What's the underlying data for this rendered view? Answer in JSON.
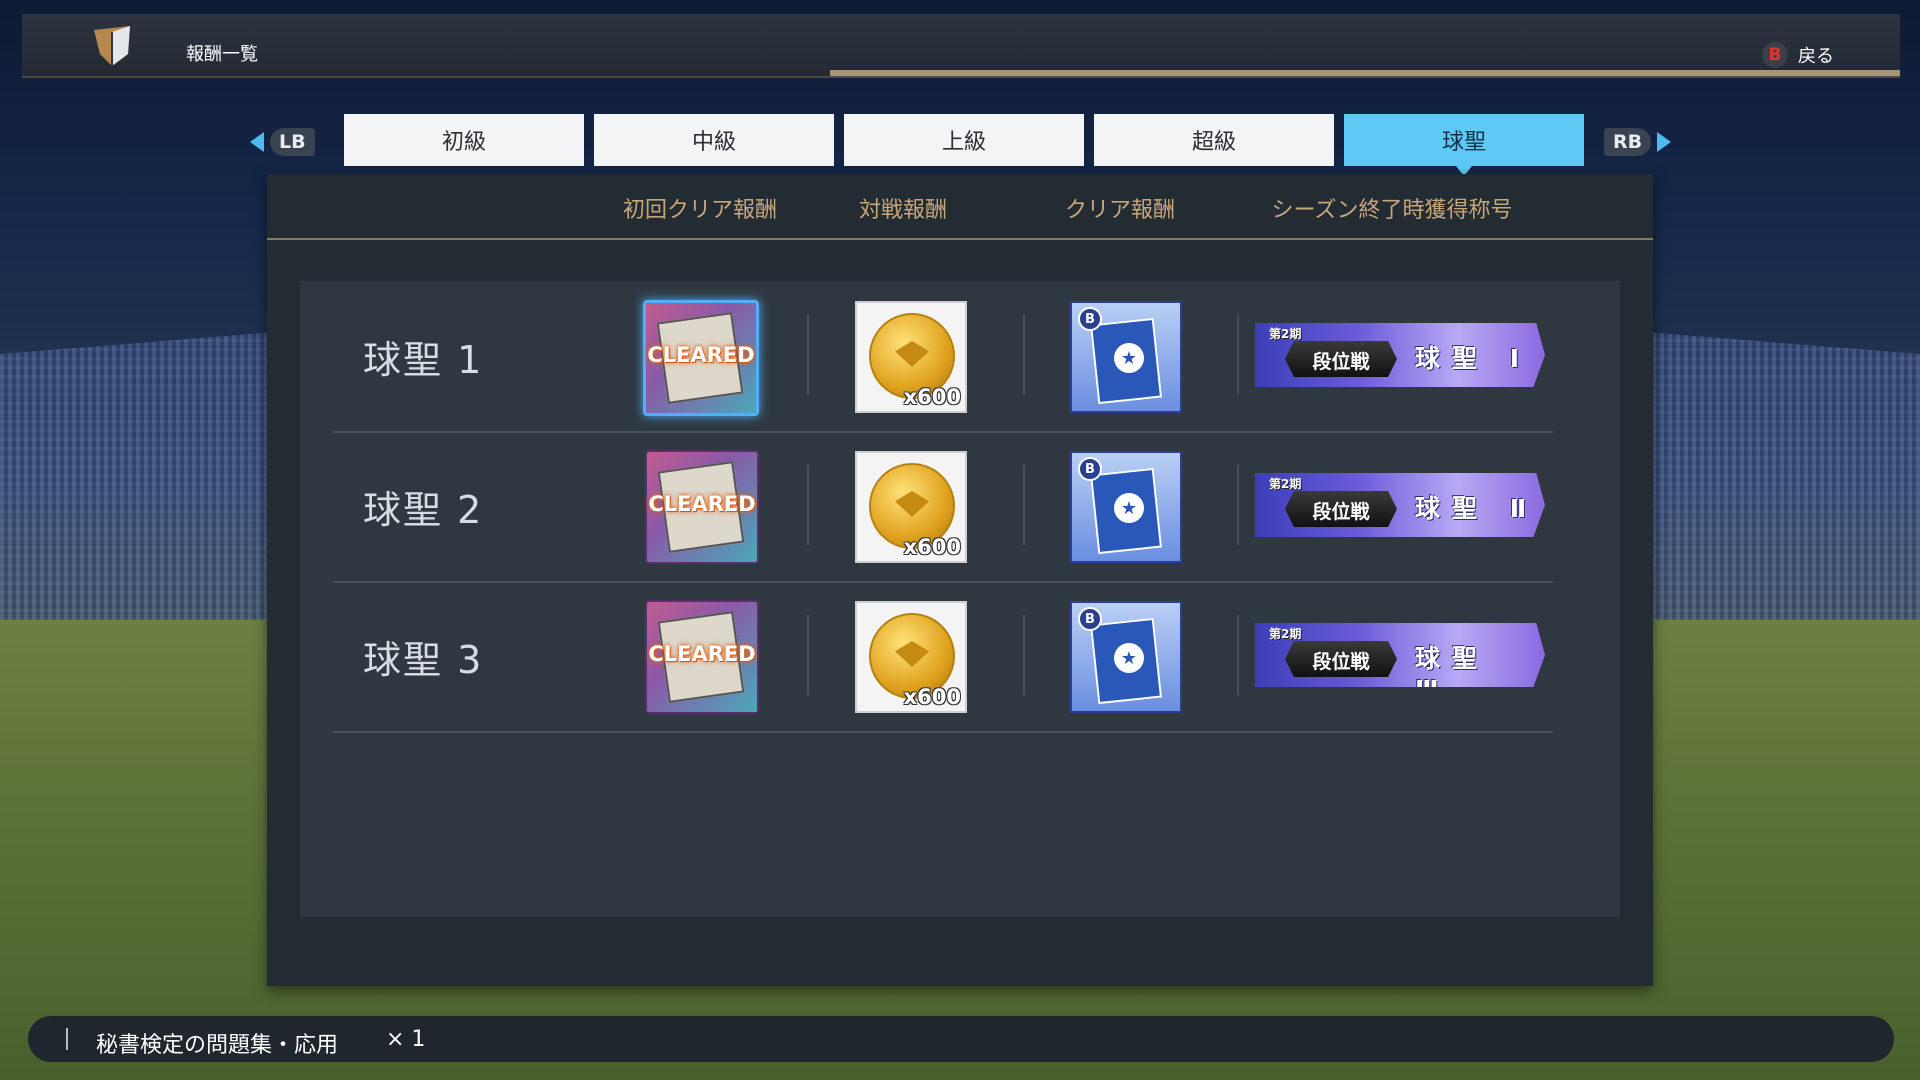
{
  "header": {
    "title": "報酬一覧",
    "back_button": "B",
    "back_label": "戻る"
  },
  "tabs": {
    "left_bumper": "LB",
    "right_bumper": "RB",
    "items": [
      {
        "label": "初級",
        "active": false
      },
      {
        "label": "中級",
        "active": false
      },
      {
        "label": "上級",
        "active": false
      },
      {
        "label": "超級",
        "active": false
      },
      {
        "label": "球聖",
        "active": true
      }
    ]
  },
  "columns": [
    "初回クリア報酬",
    "対戦報酬",
    "クリア報酬",
    "シーズン終了時獲得称号"
  ],
  "rows": [
    {
      "label": "球聖 1",
      "first_clear": "CLEARED",
      "battle_qty": "x600",
      "clear_badge": "B",
      "title_season": "第2期",
      "title_left": "段位戦",
      "title_right": "球聖 Ⅰ",
      "selected": true
    },
    {
      "label": "球聖 2",
      "first_clear": "CLEARED",
      "battle_qty": "x600",
      "clear_badge": "B",
      "title_season": "第2期",
      "title_left": "段位戦",
      "title_right": "球聖 Ⅱ",
      "selected": false
    },
    {
      "label": "球聖 3",
      "first_clear": "CLEARED",
      "battle_qty": "x600",
      "clear_badge": "B",
      "title_season": "第2期",
      "title_left": "段位戦",
      "title_right": "球聖 Ⅲ",
      "selected": false
    }
  ],
  "footer": {
    "item_name": "秘書検定の問題集・応用",
    "quantity": "× 1"
  },
  "colors": {
    "accent": "#5ec9f4",
    "column_header": "#c7a67a",
    "cleared_glow": "#e0651a"
  },
  "icons": [
    "logo-icon",
    "arrow-left-icon",
    "arrow-right-icon",
    "book-icon",
    "coin-icon",
    "card-icon",
    "title-badge-icon"
  ]
}
